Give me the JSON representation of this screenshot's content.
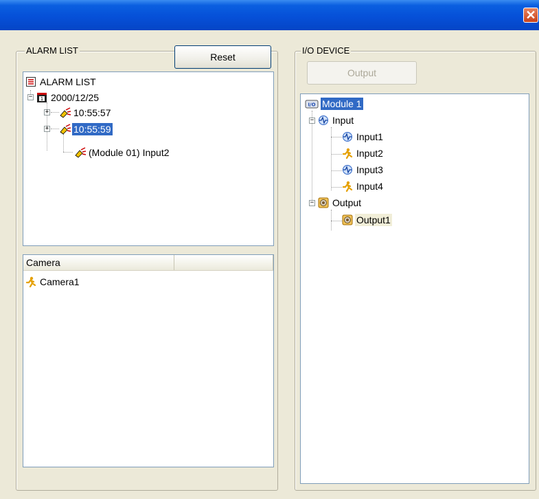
{
  "window": {
    "close_glyph": "✕"
  },
  "alarm_list": {
    "group_title": "ALARM LIST",
    "reset_label": "Reset",
    "tree": {
      "root": "ALARM LIST",
      "date": "2000/12/25",
      "event1": "10:55:57",
      "event2": "10:55:59",
      "event2_child": "(Module 01) Input2"
    }
  },
  "camera_list": {
    "columns": [
      "Camera",
      ""
    ],
    "rows": [
      "Camera1"
    ]
  },
  "io_device": {
    "group_title": "I/O DEVICE",
    "output_label": "Output",
    "tree": {
      "module": "Module 1",
      "module_badge": "I/O",
      "input_group": "Input",
      "inputs": [
        "Input1",
        "Input2",
        "Input3",
        "Input4"
      ],
      "output_group": "Output",
      "outputs": [
        "Output1"
      ]
    }
  },
  "colors": {
    "selection": "#316AC5",
    "dialog_bg": "#ECE9D8",
    "titlebar": "#0650D8",
    "close": "#C9431B"
  },
  "icons": {
    "root": "list-icon",
    "date": "calendar-icon",
    "event": "alarm-plug-icon",
    "module": "io-module-icon",
    "input_group": "signal-wave-icon",
    "input_signal": "signal-wave-icon",
    "input_person": "running-person-icon",
    "output": "speaker-icon",
    "camera": "running-person-icon"
  }
}
